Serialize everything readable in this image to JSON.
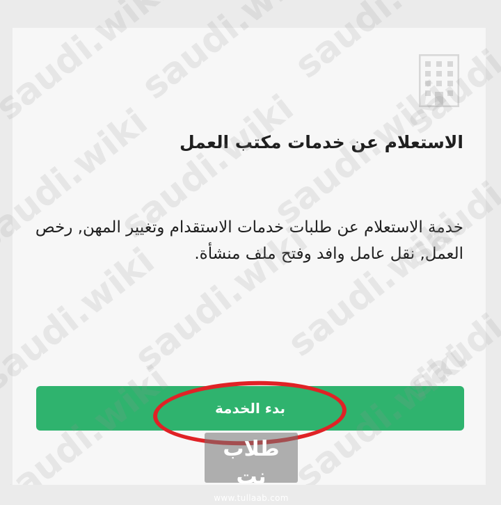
{
  "card": {
    "icon": "building-icon",
    "title": "الاستعلام عن خدمات مكتب العمل",
    "description": "خدمة الاستعلام عن طلبات خدمات الاستقدام وتغيير المهن, رخص العمل, نقل عامل وافد وفتح ملف منشأة.",
    "start_button_label": "بدء الخدمة",
    "button_color": "#2fb36e"
  },
  "annotation": {
    "highlight_color": "#e02226"
  },
  "watermark": {
    "text": "saudi.wiki"
  },
  "corner_logo": {
    "text": "طلاب نت",
    "url": "www.tullaab.com"
  }
}
